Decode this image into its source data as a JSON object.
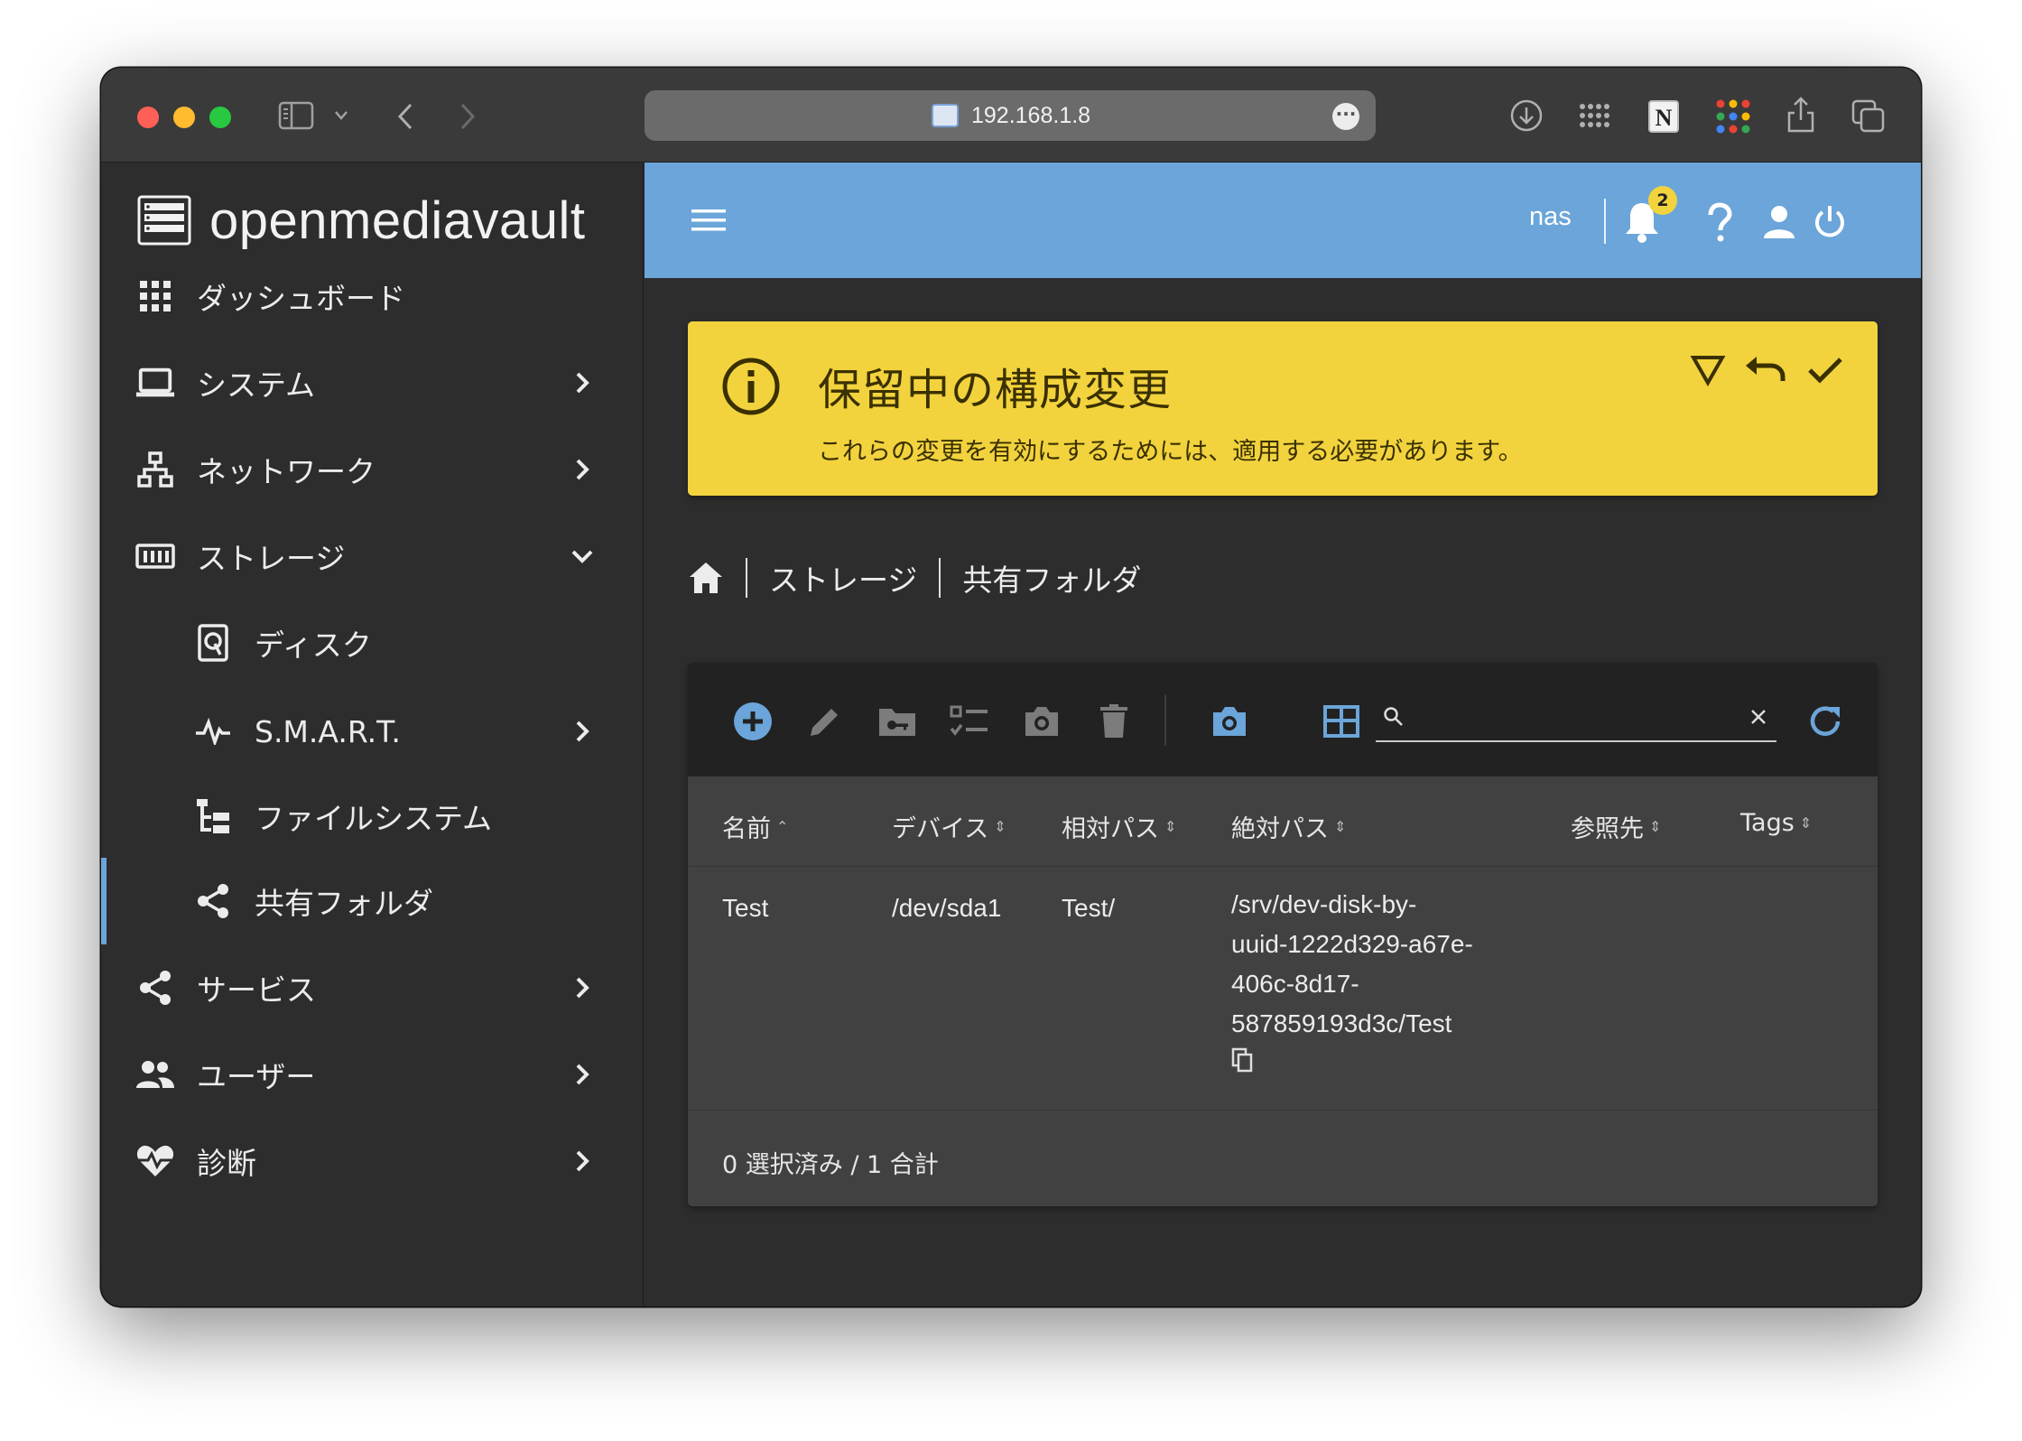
{
  "browser": {
    "url": "192.168.1.8",
    "toolbar_icons": [
      "sidebar-icon",
      "chevron-down-icon",
      "back-icon",
      "forward-icon",
      "page-icon",
      "more-icon",
      "download-icon",
      "extensions-grid-icon",
      "notion-icon",
      "apps-icon",
      "share-icon",
      "tabs-icon"
    ]
  },
  "app": {
    "brand": "openmediavault",
    "accent_color": "#6ba5d9",
    "alert_color": "#f2d33e"
  },
  "sidebar": {
    "items": [
      {
        "label": "ダッシュボード",
        "icon": "dashboard-icon"
      },
      {
        "label": "システム",
        "icon": "laptop-icon"
      },
      {
        "label": "ネットワーク",
        "icon": "network-icon"
      },
      {
        "label": "ストレージ",
        "icon": "storage-icon",
        "expanded": true
      },
      {
        "label": "ディスク",
        "icon": "disk-icon"
      },
      {
        "label": "S.M.A.R.T.",
        "icon": "pulse-icon"
      },
      {
        "label": "ファイルシステム",
        "icon": "filesystem-tree-icon"
      },
      {
        "label": "共有フォルダ",
        "icon": "share-icon",
        "active": true
      },
      {
        "label": "サービス",
        "icon": "share-icon"
      },
      {
        "label": "ユーザー",
        "icon": "users-icon"
      },
      {
        "label": "診断",
        "icon": "heart-pulse-icon"
      }
    ]
  },
  "topbar": {
    "hostname": "nas",
    "notification_count": "2"
  },
  "alert": {
    "title": "保留中の構成変更",
    "message": "これらの変更を有効にするためには、適用する必要があります。"
  },
  "breadcrumb": {
    "items": [
      "ストレージ",
      "共有フォルダ"
    ]
  },
  "table": {
    "columns": [
      "名前",
      "デバイス",
      "相対パス",
      "絶対パス",
      "参照先",
      "Tags"
    ],
    "rows": [
      {
        "name": "Test",
        "device": "/dev/sda1",
        "relative_path": "Test/",
        "absolute_path_lines": [
          "/srv/dev-disk-by-",
          "uuid-1222d329-a67e-",
          "406c-8d17-",
          "587859193d3c/Test"
        ],
        "referenced": "",
        "tags": ""
      }
    ],
    "footer": "0 選択済み / 1 合計",
    "search": {
      "value": ""
    }
  }
}
